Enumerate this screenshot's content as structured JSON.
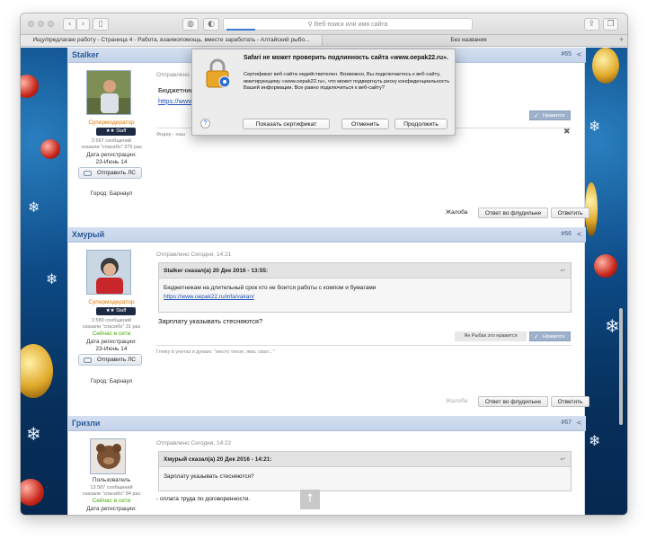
{
  "browser": {
    "address_placeholder": "Веб-поиск или имя сайта",
    "tabs": [
      {
        "label": "Ищу/предлагаю работу - Страница 4 - Работа, взаимопомощь, вместе заработать - Алтайский рыбо..."
      },
      {
        "label": "Без названия"
      }
    ],
    "new_tab": "+"
  },
  "dialog": {
    "title": "Safari не может проверить подлинность сайта «www.oepak22.ru».",
    "body": "Сертификат веб-сайта недействителен. Возможно, Вы подключаетесь к веб-сайту, имитирующему «www.oepak22.ru», что может подвергнуть риску конфиденциальность Вашей информации. Все равно подключиться к веб-сайту?",
    "help": "?",
    "show_cert": "Показать сертификат",
    "cancel": "Отменить",
    "continue": "Продолжить"
  },
  "posts": [
    {
      "author": "Stalker",
      "number": "#65",
      "role": "Супермодератор",
      "badge": "★★ Staff",
      "stats_messages": "3 567 сообщений",
      "stats_thanks": "сказали \"спасибо\" 375 раз",
      "reg_label": "Дата регистрации:",
      "reg_date": "23-Июнь 14",
      "pm": "Отправить ЛС",
      "city": "Город: Барнаул",
      "sent": "Отправлено",
      "text": "Бюджетник",
      "link": "https://www",
      "like": "Нравится",
      "signature": "Фидер - наш",
      "report": "Жалоба",
      "reply_flood": "Ответ во флудильне",
      "reply": "Ответить"
    },
    {
      "author": "Хмурый",
      "number": "#66",
      "role": "Супермодератор",
      "badge": "★★ Staff",
      "stats_messages": "3 580 сообщений",
      "stats_thanks": "сказали \"спасибо\" 31 раз",
      "online": "Сейчас в сети",
      "reg_label": "Дата регистрации:",
      "reg_date": "23-Июнь 14",
      "pm": "Отправить ЛС",
      "city": "Город: Барнаул",
      "sent": "Отправлено Сегодня, 14:21",
      "quote_head": "Stalker сказал(а) 20 Дек 2016 - 13:55:",
      "quote_text": "Бюджетникам на длительный срок кто не боится работы с компом и бумагами",
      "quote_link": "https://www.oepak22.ru/infa/vakan/",
      "text": "Зарплату указывать стесняются?",
      "liked_by": "Ян Рыбак это нравится",
      "like": "Нравится",
      "signature": "Гляжу в унитаз и думаю: \"место тихое, яма, свал...\"",
      "report": "Жалоба",
      "reply_flood": "Ответ во флудильне",
      "reply": "Ответить"
    },
    {
      "author": "Гризли",
      "number": "#67",
      "role": "Пользователь",
      "stats_messages": "13 587 сообщений",
      "stats_thanks": "сказали \"спасибо\" 84 раз",
      "online": "Сейчас в сети",
      "reg_label": "Дата регистрации:",
      "sent": "Отправлено Сегодня, 14:22",
      "quote_head": "Хмурый сказал(а) 20 Дек 2016 - 14:21:",
      "quote_text": "Зарплату указывать стесняются?",
      "text": "- оплата труда по договоренности."
    }
  ]
}
